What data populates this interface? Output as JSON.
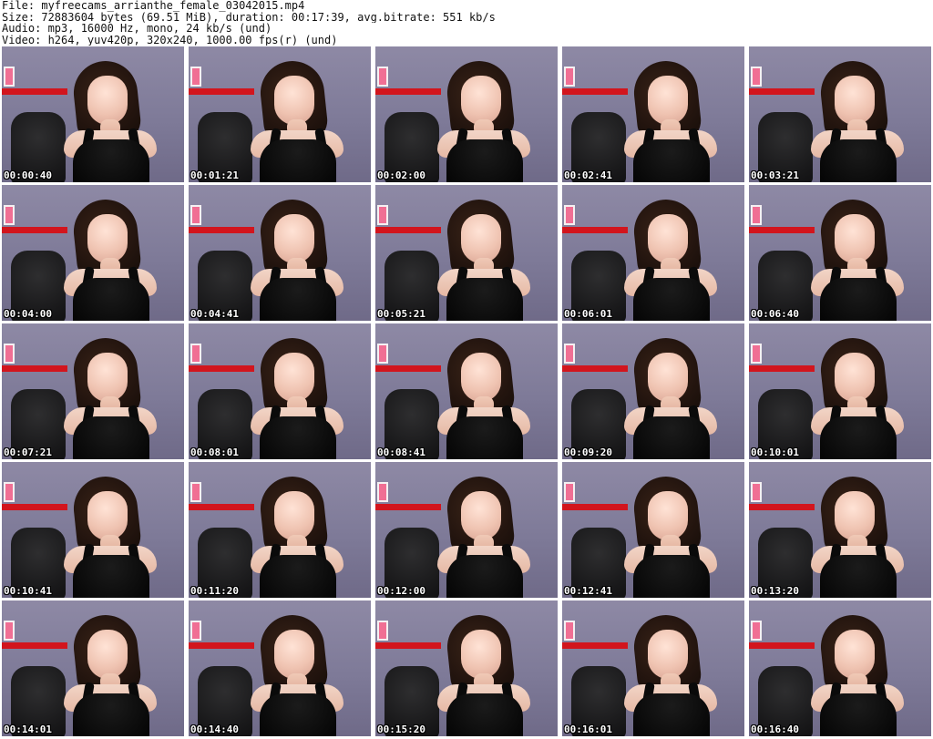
{
  "header": {
    "file_line": "File: myfreecams_arrianthe_female_03042015.mp4",
    "size_line": "Size: 72883604 bytes (69.51 MiB), duration: 00:17:39, avg.bitrate: 551 kb/s",
    "audio_line": "Audio: mp3, 16000 Hz, mono, 24 kb/s (und)",
    "video_line": "Video: h264, yuv420p, 320x240, 1000.00 fps(r) (und)"
  },
  "thumbnails": [
    {
      "timestamp": "00:00:40"
    },
    {
      "timestamp": "00:01:21"
    },
    {
      "timestamp": "00:02:00"
    },
    {
      "timestamp": "00:02:41"
    },
    {
      "timestamp": "00:03:21"
    },
    {
      "timestamp": "00:04:00"
    },
    {
      "timestamp": "00:04:41"
    },
    {
      "timestamp": "00:05:21"
    },
    {
      "timestamp": "00:06:01"
    },
    {
      "timestamp": "00:06:40"
    },
    {
      "timestamp": "00:07:21"
    },
    {
      "timestamp": "00:08:01"
    },
    {
      "timestamp": "00:08:41"
    },
    {
      "timestamp": "00:09:20"
    },
    {
      "timestamp": "00:10:01"
    },
    {
      "timestamp": "00:10:41"
    },
    {
      "timestamp": "00:11:20"
    },
    {
      "timestamp": "00:12:00"
    },
    {
      "timestamp": "00:12:41"
    },
    {
      "timestamp": "00:13:20"
    },
    {
      "timestamp": "00:14:01"
    },
    {
      "timestamp": "00:14:40"
    },
    {
      "timestamp": "00:15:20"
    },
    {
      "timestamp": "00:16:01"
    },
    {
      "timestamp": "00:16:40"
    }
  ]
}
